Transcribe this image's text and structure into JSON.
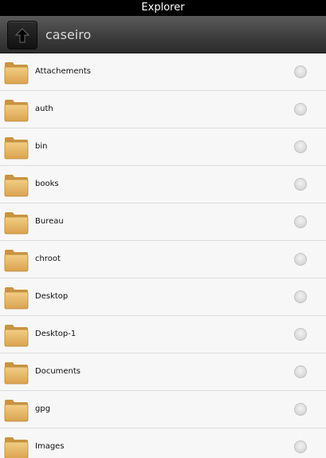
{
  "app": {
    "title": "Explorer"
  },
  "path_bar": {
    "current_folder": "caseiro",
    "up_icon": "arrow-up-icon"
  },
  "colors": {
    "title_bar_bg": "#000000",
    "folder": "#e8b96a",
    "radio": "#d9d9d9"
  },
  "files": [
    {
      "name": "Attachements",
      "icon": "folder-icon",
      "selected": false
    },
    {
      "name": "auth",
      "icon": "folder-icon",
      "selected": false
    },
    {
      "name": "bin",
      "icon": "folder-icon",
      "selected": false
    },
    {
      "name": "books",
      "icon": "folder-icon",
      "selected": false
    },
    {
      "name": "Bureau",
      "icon": "folder-icon",
      "selected": false
    },
    {
      "name": "chroot",
      "icon": "folder-icon",
      "selected": false
    },
    {
      "name": "Desktop",
      "icon": "folder-icon",
      "selected": false
    },
    {
      "name": "Desktop-1",
      "icon": "folder-icon",
      "selected": false
    },
    {
      "name": "Documents",
      "icon": "folder-icon",
      "selected": false
    },
    {
      "name": "gpg",
      "icon": "folder-icon",
      "selected": false
    },
    {
      "name": "Images",
      "icon": "folder-icon",
      "selected": false
    }
  ]
}
